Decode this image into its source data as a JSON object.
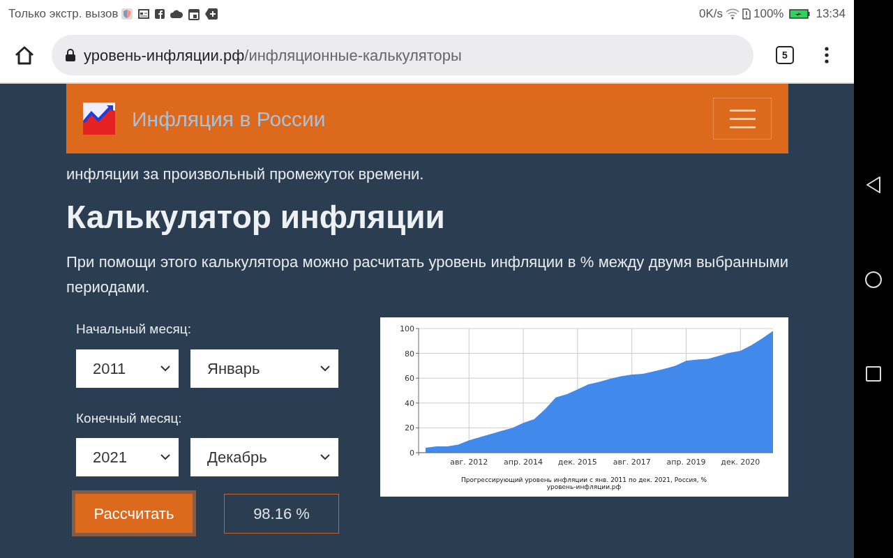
{
  "status_bar": {
    "carrier": "Только экстр. вызов",
    "speed": "0K/s",
    "battery": "100%",
    "time": "13:34"
  },
  "browser": {
    "url_domain": "уровень-инфляции.рф",
    "url_path": "/инфляционные-калькуляторы",
    "tab_count": "5"
  },
  "site_header": {
    "title": "Инфляция в России"
  },
  "intro_text": "инфляции за произвольный промежуток времени.",
  "heading": "Калькулятор инфляции",
  "description": "При помощи этого калькулятора можно расчитать уровень инфляции в % между двумя выбранными периодами.",
  "form": {
    "start_label": "Начальный месяц:",
    "start_year": "2011",
    "start_month": "Январь",
    "end_label": "Конечный месяц:",
    "end_year": "2021",
    "end_month": "Декабрь",
    "button": "Рассчитать",
    "result": "98.16 %"
  },
  "chart": {
    "chart_data": {
      "type": "area",
      "title": "Прогрессирующий уровень инфляции с янв. 2011 по дек. 2021, Россия, %",
      "categories": [
        null,
        null,
        null,
        null,
        "авг. 2012",
        null,
        null,
        null,
        null,
        "апр. 2014",
        null,
        null,
        null,
        null,
        "дек. 2015",
        null,
        null,
        null,
        null,
        "авг. 2017",
        null,
        null,
        null,
        null,
        "апр. 2019",
        null,
        null,
        null,
        null,
        "дек. 2020",
        null,
        null,
        null
      ],
      "series": [
        {
          "color": "#4289ec",
          "values": [
            4,
            5,
            5,
            6.5,
            10,
            12.5,
            15,
            17.5,
            20,
            24,
            27,
            35,
            44.5,
            47,
            51,
            55,
            57,
            59.5,
            61.5,
            63,
            63.5,
            65.5,
            67.5,
            70,
            74,
            75,
            75.5,
            78,
            80.5,
            82,
            86.5,
            92,
            98
          ]
        }
      ],
      "ylim": [
        0,
        100
      ],
      "grid": true,
      "yticks": [
        0,
        20,
        40,
        60,
        80,
        100
      ]
    },
    "source": "уровень-инфляции.рф"
  }
}
